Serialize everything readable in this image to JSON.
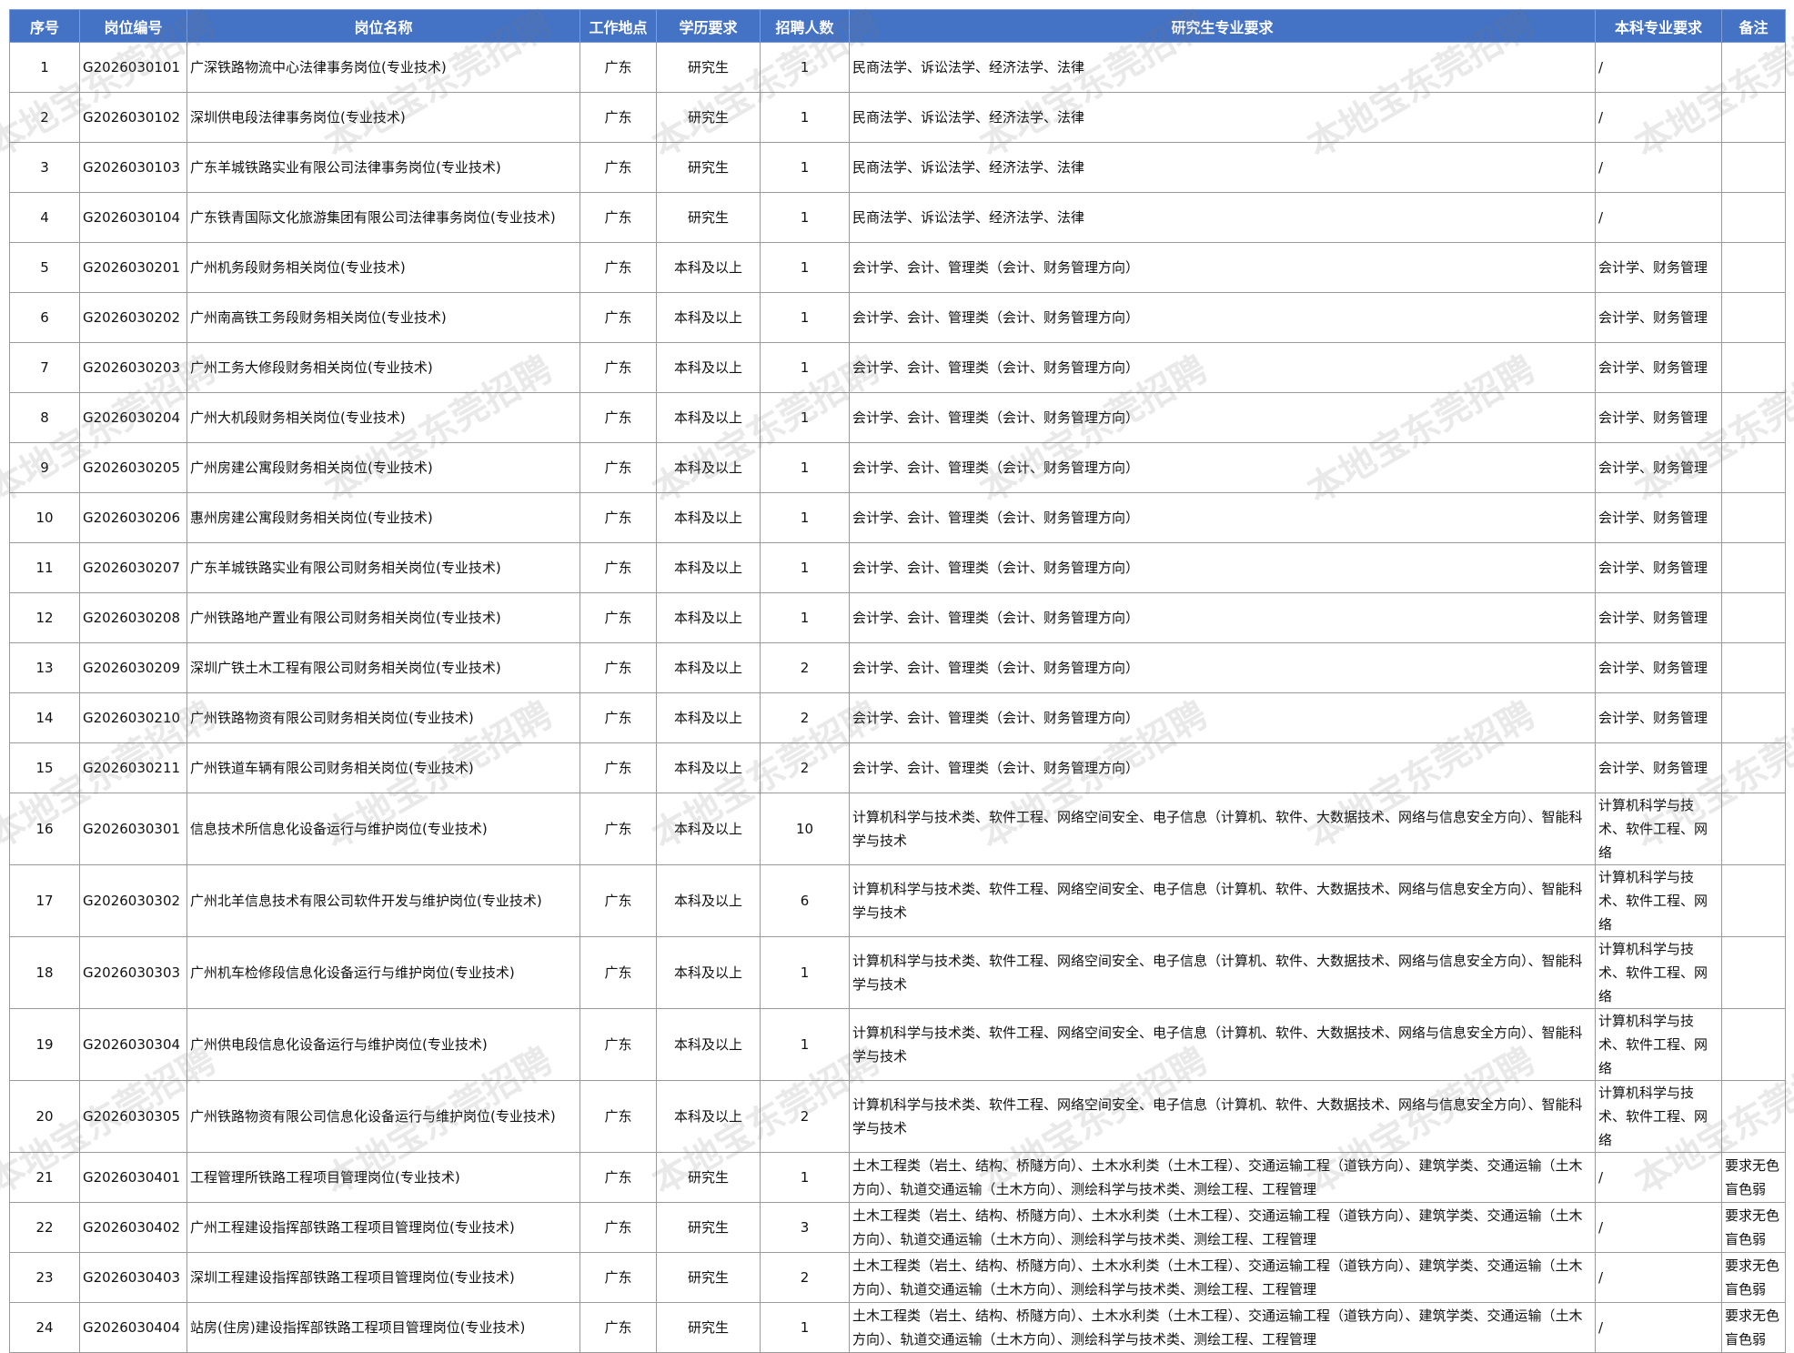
{
  "table": {
    "headers": [
      "序号",
      "岗位编号",
      "岗位名称",
      "工作地点",
      "学历要求",
      "招聘人数",
      "研究生专业要求",
      "本科专业要求",
      "备注"
    ],
    "rows": [
      [
        "1",
        "G2026030101",
        "广深铁路物流中心法律事务岗位(专业技术)",
        "广东",
        "研究生",
        "1",
        "民商法学、诉讼法学、经济法学、法律",
        "/",
        ""
      ],
      [
        "2",
        "G2026030102",
        "深圳供电段法律事务岗位(专业技术)",
        "广东",
        "研究生",
        "1",
        "民商法学、诉讼法学、经济法学、法律",
        "/",
        ""
      ],
      [
        "3",
        "G2026030103",
        "广东羊城铁路实业有限公司法律事务岗位(专业技术)",
        "广东",
        "研究生",
        "1",
        "民商法学、诉讼法学、经济法学、法律",
        "/",
        ""
      ],
      [
        "4",
        "G2026030104",
        "广东铁青国际文化旅游集团有限公司法律事务岗位(专业技术)",
        "广东",
        "研究生",
        "1",
        "民商法学、诉讼法学、经济法学、法律",
        "/",
        ""
      ],
      [
        "5",
        "G2026030201",
        "广州机务段财务相关岗位(专业技术)",
        "广东",
        "本科及以上",
        "1",
        "会计学、会计、管理类（会计、财务管理方向）",
        "会计学、财务管理",
        ""
      ],
      [
        "6",
        "G2026030202",
        "广州南高铁工务段财务相关岗位(专业技术)",
        "广东",
        "本科及以上",
        "1",
        "会计学、会计、管理类（会计、财务管理方向）",
        "会计学、财务管理",
        ""
      ],
      [
        "7",
        "G2026030203",
        "广州工务大修段财务相关岗位(专业技术)",
        "广东",
        "本科及以上",
        "1",
        "会计学、会计、管理类（会计、财务管理方向）",
        "会计学、财务管理",
        ""
      ],
      [
        "8",
        "G2026030204",
        "广州大机段财务相关岗位(专业技术)",
        "广东",
        "本科及以上",
        "1",
        "会计学、会计、管理类（会计、财务管理方向）",
        "会计学、财务管理",
        ""
      ],
      [
        "9",
        "G2026030205",
        "广州房建公寓段财务相关岗位(专业技术)",
        "广东",
        "本科及以上",
        "1",
        "会计学、会计、管理类（会计、财务管理方向）",
        "会计学、财务管理",
        ""
      ],
      [
        "10",
        "G2026030206",
        "惠州房建公寓段财务相关岗位(专业技术)",
        "广东",
        "本科及以上",
        "1",
        "会计学、会计、管理类（会计、财务管理方向）",
        "会计学、财务管理",
        ""
      ],
      [
        "11",
        "G2026030207",
        "广东羊城铁路实业有限公司财务相关岗位(专业技术)",
        "广东",
        "本科及以上",
        "1",
        "会计学、会计、管理类（会计、财务管理方向）",
        "会计学、财务管理",
        ""
      ],
      [
        "12",
        "G2026030208",
        "广州铁路地产置业有限公司财务相关岗位(专业技术)",
        "广东",
        "本科及以上",
        "1",
        "会计学、会计、管理类（会计、财务管理方向）",
        "会计学、财务管理",
        ""
      ],
      [
        "13",
        "G2026030209",
        "深圳广铁土木工程有限公司财务相关岗位(专业技术)",
        "广东",
        "本科及以上",
        "2",
        "会计学、会计、管理类（会计、财务管理方向）",
        "会计学、财务管理",
        ""
      ],
      [
        "14",
        "G2026030210",
        "广州铁路物资有限公司财务相关岗位(专业技术)",
        "广东",
        "本科及以上",
        "2",
        "会计学、会计、管理类（会计、财务管理方向）",
        "会计学、财务管理",
        ""
      ],
      [
        "15",
        "G2026030211",
        "广州铁道车辆有限公司财务相关岗位(专业技术)",
        "广东",
        "本科及以上",
        "2",
        "会计学、会计、管理类（会计、财务管理方向）",
        "会计学、财务管理",
        ""
      ],
      [
        "16",
        "G2026030301",
        "信息技术所信息化设备运行与维护岗位(专业技术)",
        "广东",
        "本科及以上",
        "10",
        "计算机科学与技术类、软件工程、网络空间安全、电子信息（计算机、软件、大数据技术、网络与信息安全方向）、智能科学与技术",
        "计算机科学与技术、软件工程、网络",
        ""
      ],
      [
        "17",
        "G2026030302",
        "广州北羊信息技术有限公司软件开发与维护岗位(专业技术)",
        "广东",
        "本科及以上",
        "6",
        "计算机科学与技术类、软件工程、网络空间安全、电子信息（计算机、软件、大数据技术、网络与信息安全方向）、智能科学与技术",
        "计算机科学与技术、软件工程、网络",
        ""
      ],
      [
        "18",
        "G2026030303",
        "广州机车检修段信息化设备运行与维护岗位(专业技术)",
        "广东",
        "本科及以上",
        "1",
        "计算机科学与技术类、软件工程、网络空间安全、电子信息（计算机、软件、大数据技术、网络与信息安全方向）、智能科学与技术",
        "计算机科学与技术、软件工程、网络",
        ""
      ],
      [
        "19",
        "G2026030304",
        "广州供电段信息化设备运行与维护岗位(专业技术)",
        "广东",
        "本科及以上",
        "1",
        "计算机科学与技术类、软件工程、网络空间安全、电子信息（计算机、软件、大数据技术、网络与信息安全方向）、智能科学与技术",
        "计算机科学与技术、软件工程、网络",
        ""
      ],
      [
        "20",
        "G2026030305",
        "广州铁路物资有限公司信息化设备运行与维护岗位(专业技术)",
        "广东",
        "本科及以上",
        "2",
        "计算机科学与技术类、软件工程、网络空间安全、电子信息（计算机、软件、大数据技术、网络与信息安全方向）、智能科学与技术",
        "计算机科学与技术、软件工程、网络",
        ""
      ],
      [
        "21",
        "G2026030401",
        "工程管理所铁路工程项目管理岗位(专业技术)",
        "广东",
        "研究生",
        "1",
        "土木工程类（岩土、结构、桥隧方向）、土木水利类（土木工程）、交通运输工程（道铁方向）、建筑学类、交通运输（土木方向）、轨道交通运输（土木方向）、测绘科学与技术类、测绘工程、工程管理",
        "/",
        "要求无色盲色弱"
      ],
      [
        "22",
        "G2026030402",
        "广州工程建设指挥部铁路工程项目管理岗位(专业技术)",
        "广东",
        "研究生",
        "3",
        "土木工程类（岩土、结构、桥隧方向）、土木水利类（土木工程）、交通运输工程（道铁方向）、建筑学类、交通运输（土木方向）、轨道交通运输（土木方向）、测绘科学与技术类、测绘工程、工程管理",
        "/",
        "要求无色盲色弱"
      ],
      [
        "23",
        "G2026030403",
        "深圳工程建设指挥部铁路工程项目管理岗位(专业技术)",
        "广东",
        "研究生",
        "2",
        "土木工程类（岩土、结构、桥隧方向）、土木水利类（土木工程）、交通运输工程（道铁方向）、建筑学类、交通运输（土木方向）、轨道交通运输（土木方向）、测绘科学与技术类、测绘工程、工程管理",
        "/",
        "要求无色盲色弱"
      ],
      [
        "24",
        "G2026030404",
        "站房(住房)建设指挥部铁路工程项目管理岗位(专业技术)",
        "广东",
        "研究生",
        "1",
        "土木工程类（岩土、结构、桥隧方向）、土木水利类（土木工程）、交通运输工程（道铁方向）、建筑学类、交通运输（土木方向）、轨道交通运输（土木方向）、测绘科学与技术类、测绘工程、工程管理",
        "/",
        "要求无色盲色弱"
      ]
    ]
  },
  "watermark": "本地宝东莞招聘",
  "colors": {
    "header_bg": "#4472c4",
    "header_text": "#ffffff",
    "grid": "#9a9a9a"
  }
}
